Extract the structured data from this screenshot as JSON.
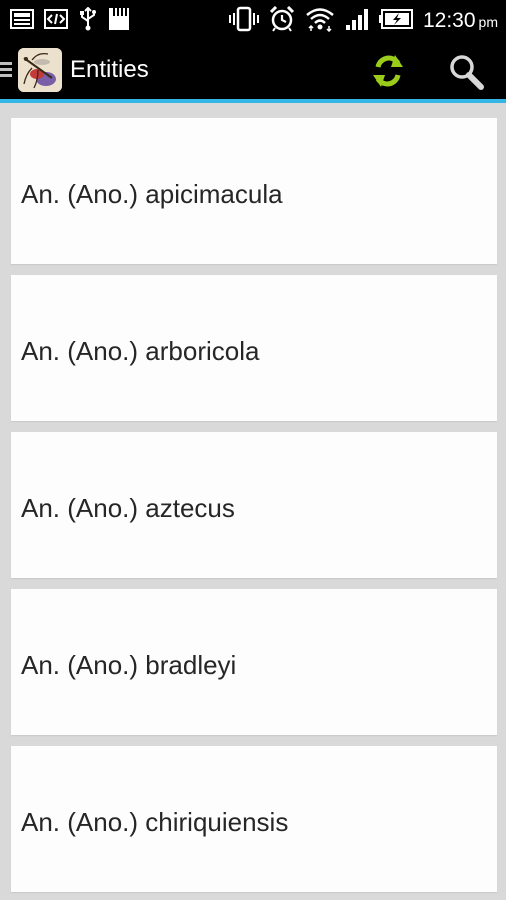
{
  "status_bar": {
    "time": "12:30",
    "ampm": "pm",
    "left_icons": [
      "gallery-icon",
      "code-icon",
      "usb-icon",
      "sd-card-icon"
    ],
    "right_icons": [
      "vibrate-icon",
      "alarm-icon",
      "wifi-icon",
      "signal-icon",
      "battery-charging-icon"
    ]
  },
  "action_bar": {
    "title": "Entities",
    "app_icon": "mosquito-app-icon",
    "actions": [
      {
        "name": "refresh",
        "icon": "refresh-icon",
        "color": "#9acd1a"
      },
      {
        "name": "search",
        "icon": "search-icon",
        "color": "#d8d8d8"
      }
    ],
    "accent_color": "#33b5e5"
  },
  "entities": [
    {
      "label": "An. (Ano.) apicimacula"
    },
    {
      "label": "An. (Ano.) arboricola"
    },
    {
      "label": "An. (Ano.) aztecus"
    },
    {
      "label": "An. (Ano.) bradleyi"
    },
    {
      "label": "An. (Ano.) chiriquiensis"
    }
  ]
}
